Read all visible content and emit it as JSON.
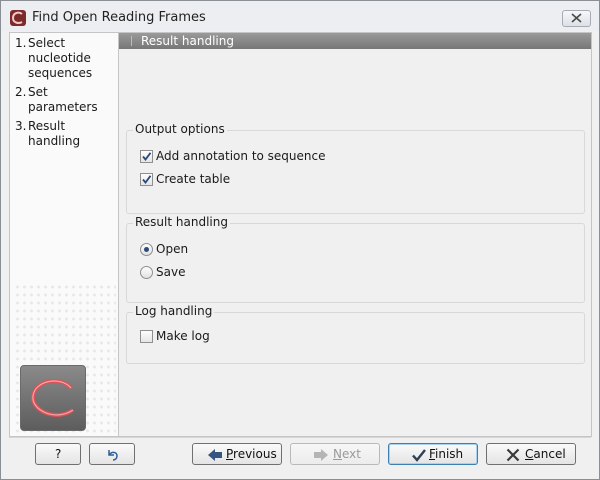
{
  "window": {
    "title": "Find Open Reading Frames",
    "close_icon": "close-icon"
  },
  "steps": [
    {
      "num": "1.",
      "label": "Select nucleotide sequences"
    },
    {
      "num": "2.",
      "label": "Set parameters"
    },
    {
      "num": "3.",
      "label": "Result handling"
    }
  ],
  "content": {
    "header": "Result handling",
    "output_options": {
      "title": "Output options",
      "add_annotation": {
        "label": "Add annotation to sequence",
        "checked": true
      },
      "create_table": {
        "label": "Create table",
        "checked": true
      }
    },
    "result_handling": {
      "title": "Result handling",
      "open": {
        "label": "Open",
        "selected": true
      },
      "save": {
        "label": "Save",
        "selected": false
      }
    },
    "log_handling": {
      "title": "Log handling",
      "make_log": {
        "label": "Make log",
        "checked": false
      }
    }
  },
  "buttons": {
    "help": "?",
    "previous": {
      "first": "P",
      "rest": "revious"
    },
    "next": {
      "first": "N",
      "rest": "ext"
    },
    "finish": {
      "first": "F",
      "rest": "inish"
    },
    "cancel": {
      "first": "C",
      "rest": "ancel"
    }
  },
  "colors": {
    "header_bg": "#8a8a8a",
    "focus_border": "#3c7fb1",
    "check_mark": "#2b4a7a"
  }
}
